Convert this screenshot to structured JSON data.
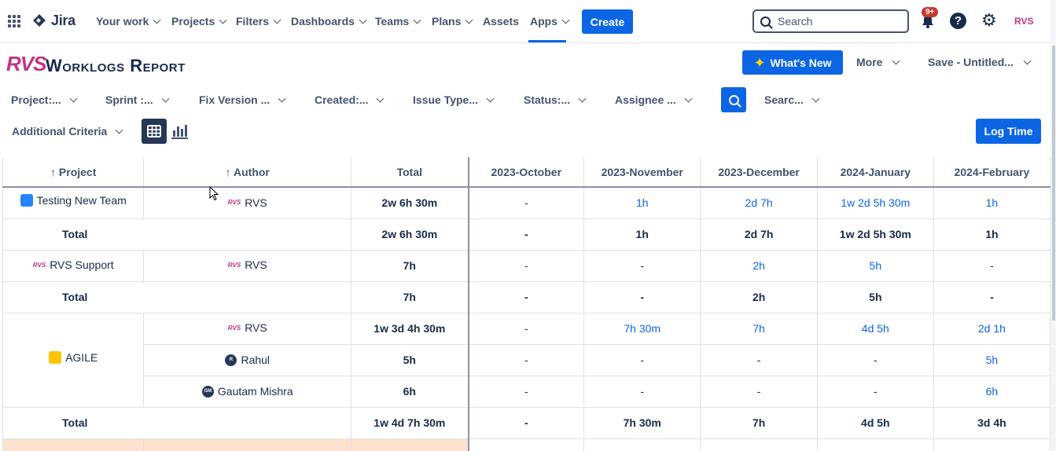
{
  "nav": {
    "brand": "Jira",
    "items": [
      "Your work",
      "Projects",
      "Filters",
      "Dashboards",
      "Teams",
      "Plans",
      "Assets",
      "Apps"
    ],
    "create_label": "Create",
    "search_placeholder": "Search",
    "notification_badge": "9+",
    "help_glyph": "?",
    "profile_logo": "RVS",
    "accent_color": "#0c66e4"
  },
  "header": {
    "brand_logo": "RVS",
    "title": "Worklogs Report",
    "whats_new_label": "What's New",
    "more_label": "More",
    "save_label": "Save - Untitled..."
  },
  "filters": {
    "items": [
      "Project:...",
      "Sprint :...",
      "Fix Version ...",
      "Created:...",
      "Issue Type...",
      "Status:...",
      "Assignee ...",
      "Searc..."
    ],
    "additional_criteria_label": "Additional Criteria",
    "log_time_label": "Log Time"
  },
  "table": {
    "headers": {
      "project": "↑ Project",
      "author": "↑ Author",
      "total": "Total",
      "months": [
        "2023-October",
        "2023-November",
        "2023-December",
        "2024-January",
        "2024-February"
      ]
    },
    "groups": [
      {
        "project": "Testing New Team",
        "icon": "rocket-icon",
        "rows": [
          {
            "author": "RVS",
            "avatar": "rvs-logo",
            "total": "2w 6h 30m",
            "months": [
              "-",
              "1h",
              "2d 7h",
              "1w 2d 5h 30m",
              "1h"
            ]
          }
        ],
        "total_label": "Total",
        "total": "2w 6h 30m",
        "total_months": [
          "-",
          "1h",
          "2d 7h",
          "1w 2d 5h 30m",
          "1h"
        ]
      },
      {
        "project": "RVS Support",
        "icon": "rvs-logo",
        "rows": [
          {
            "author": "RVS",
            "avatar": "rvs-logo",
            "total": "7h",
            "months": [
              "-",
              "-",
              "2h",
              "5h",
              "-"
            ]
          }
        ],
        "total_label": "Total",
        "total": "7h",
        "total_months": [
          "-",
          "-",
          "2h",
          "5h",
          "-"
        ]
      },
      {
        "project": "AGILE",
        "icon": "agile-icon",
        "rows": [
          {
            "author": "RVS",
            "avatar": "rvs-logo",
            "total": "1w 3d 4h 30m",
            "months": [
              "-",
              "7h 30m",
              "7h",
              "4d 5h",
              "2d 1h"
            ]
          },
          {
            "author": "Rahul",
            "avatar": "R",
            "total": "5h",
            "months": [
              "-",
              "-",
              "-",
              "-",
              "5h"
            ]
          },
          {
            "author": "Gautam Mishra",
            "avatar": "GM",
            "total": "6h",
            "months": [
              "-",
              "-",
              "-",
              "-",
              "6h"
            ]
          }
        ],
        "total_label": "Total",
        "total": "1w 4d 7h 30m",
        "total_months": [
          "-",
          "7h 30m",
          "7h",
          "4d 5h",
          "3d 4h"
        ]
      }
    ]
  }
}
